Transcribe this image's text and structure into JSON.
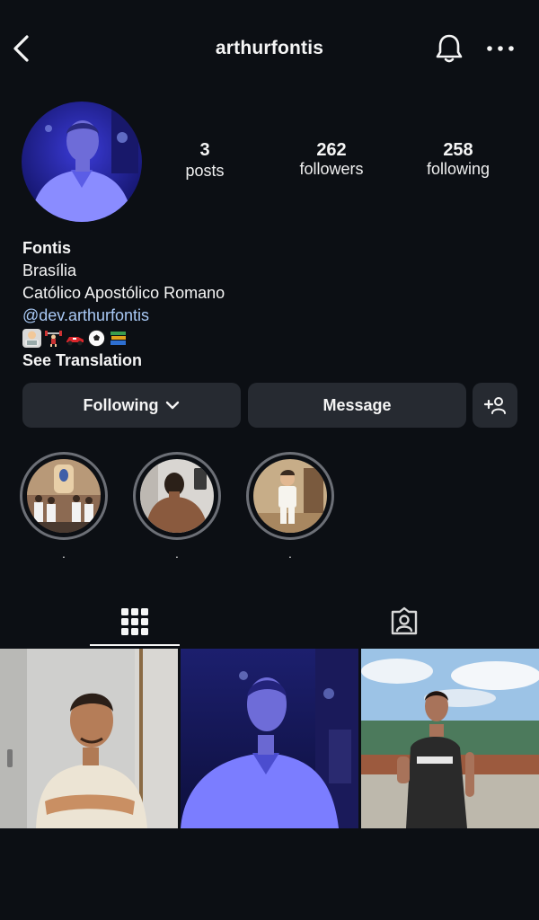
{
  "header": {
    "username": "arthurfontis",
    "back_icon": "chevron-left-icon",
    "bell_icon": "bell-icon",
    "more_icon": "more-horizontal-icon"
  },
  "stats": [
    {
      "value": "3",
      "label": "posts"
    },
    {
      "value": "262",
      "label": "followers"
    },
    {
      "value": "258",
      "label": "following"
    }
  ],
  "bio": {
    "name": "Fontis",
    "city": "Brasília",
    "religion": "Católico Apostólico Romano",
    "link": "@dev.arthurfontis",
    "emojis": [
      "technologist-emoji",
      "weightlifter-emoji",
      "race-car-emoji",
      "soccer-ball-emoji",
      "books-emoji"
    ],
    "see_translation": "See Translation"
  },
  "actions": {
    "following_label": "Following",
    "message_label": "Message",
    "add_user_icon": "add-user-icon"
  },
  "highlights": [
    {
      "label": "."
    },
    {
      "label": "."
    },
    {
      "label": "."
    }
  ],
  "tabs": {
    "grid_icon": "grid-icon",
    "tagged_icon": "tagged-person-icon",
    "active": "grid"
  },
  "colors": {
    "background": "#0c0f14",
    "button": "#262a31",
    "link": "#a9c9f5",
    "ring": "#6c6f76"
  }
}
